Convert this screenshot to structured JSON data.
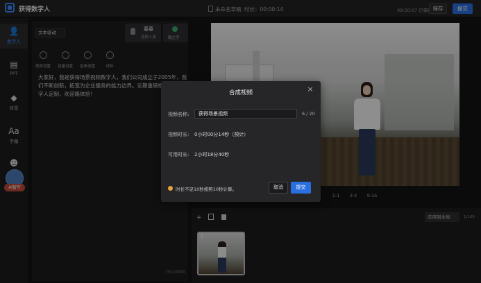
{
  "app": {
    "title": "获得数字人"
  },
  "header": {
    "doc_name": "未命名草稿",
    "duration_label": "时长：00:00:14",
    "saved_time": "09:50:07 已保存",
    "save_label": "保存",
    "submit_label": "提交"
  },
  "sidebar": {
    "items": [
      {
        "label": "数字人",
        "icon": "person-icon"
      },
      {
        "label": "PPT",
        "icon": "ppt-icon"
      },
      {
        "label": "背景",
        "icon": "background-icon"
      },
      {
        "label": "字幕",
        "icon": "subtitle-icon"
      },
      {
        "label": "贴纸",
        "icon": "sticker-icon"
      }
    ],
    "ai_badge": "AI智写"
  },
  "editor": {
    "drive_mode": "文本驱动",
    "voice_name": "春春",
    "voice_sub": "选择人像",
    "smart_label": "随之字",
    "tools": [
      "局部设置",
      "音量设置",
      "音画设置",
      "试听"
    ],
    "script": "大家好，我是获得场景视频数字人，我们公司成立于2005年，我们不断创新，拓宽为企业服务的能力边界。近期重磅推出企业数字人定制，欢迎路体验！",
    "word_count": "70/10000"
  },
  "stage": {
    "aspect_options": [
      "4",
      "1:1",
      "3:4",
      "9:16"
    ]
  },
  "timeline": {
    "apply_all_label": "应用到全局",
    "page_count": "1/100",
    "thumb_index": "1"
  },
  "modal": {
    "title": "合成视频",
    "close": "×",
    "name_label": "视频名称:",
    "name_value": "获得场景视频",
    "name_count": "6 / 20",
    "duration_label": "视频时长:",
    "duration_value": "0小时00分14秒（预计）",
    "available_label": "可用时长:",
    "available_value": "2小时18分40秒",
    "warning": "时长不足10秒按照10秒计算。",
    "cancel_label": "取消",
    "confirm_label": "提交"
  },
  "colors": {
    "accent": "#2a6fe0",
    "warning": "#e8a23a",
    "background": "#141414"
  }
}
